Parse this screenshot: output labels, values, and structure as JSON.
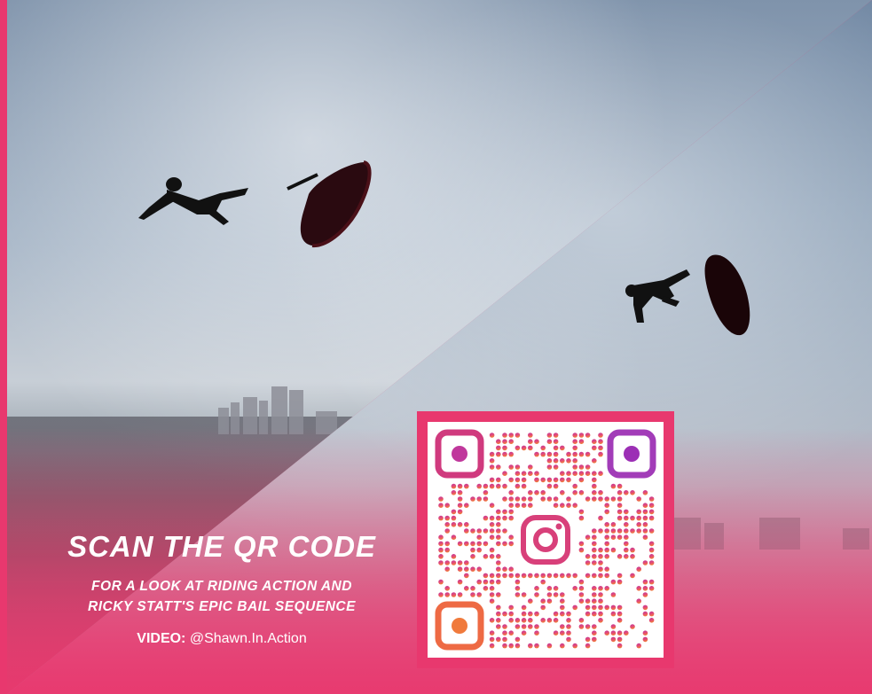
{
  "promo": {
    "headline": "SCAN THE QR CODE",
    "subline_1": "FOR A LOOK AT RIDING ACTION AND",
    "subline_2": "RICKY STATT'S EPIC BAIL SEQUENCE",
    "credit_label": "VIDEO:",
    "credit_handle": "@Shawn.In.Action"
  },
  "qr": {
    "center_icon": "instagram-icon"
  },
  "colors": {
    "brand_pink": "#e8386e",
    "qr_gradient_top": "#c0389c",
    "qr_gradient_bottom": "#f07a3c"
  }
}
